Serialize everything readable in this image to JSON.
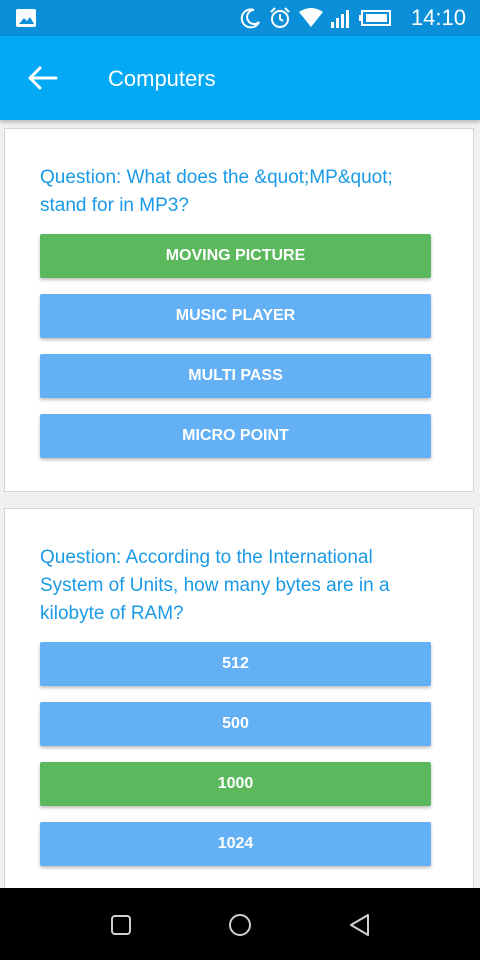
{
  "status_bar": {
    "time": "14:10",
    "icons": [
      "gallery-icon",
      "moon-icon",
      "alarm-icon",
      "wifi-icon",
      "signal-icon",
      "battery-icon"
    ]
  },
  "app_bar": {
    "title": "Computers",
    "back_icon": "arrow-back-icon"
  },
  "questions": [
    {
      "text": "Question: What does the &quot;MP&quot; stand for in MP3?",
      "answers": [
        {
          "label": "MOVING PICTURE",
          "correct": true
        },
        {
          "label": "MUSIC PLAYER",
          "correct": false
        },
        {
          "label": "MULTI PASS",
          "correct": false
        },
        {
          "label": "MICRO POINT",
          "correct": false
        }
      ]
    },
    {
      "text": "Question: According to the International System of Units, how many bytes are in a kilobyte of RAM?",
      "answers": [
        {
          "label": "512",
          "correct": false
        },
        {
          "label": "500",
          "correct": false
        },
        {
          "label": "1000",
          "correct": true
        },
        {
          "label": "1024",
          "correct": false
        }
      ]
    }
  ],
  "colors": {
    "status_bar": "#0a8fd8",
    "app_bar": "#03a9f4",
    "question_text": "#1a9ae6",
    "answer_default": "#64b0f5",
    "answer_correct": "#5cb85c"
  },
  "nav_bar": [
    "square-nav-icon",
    "circle-nav-icon",
    "triangle-back-nav-icon"
  ]
}
